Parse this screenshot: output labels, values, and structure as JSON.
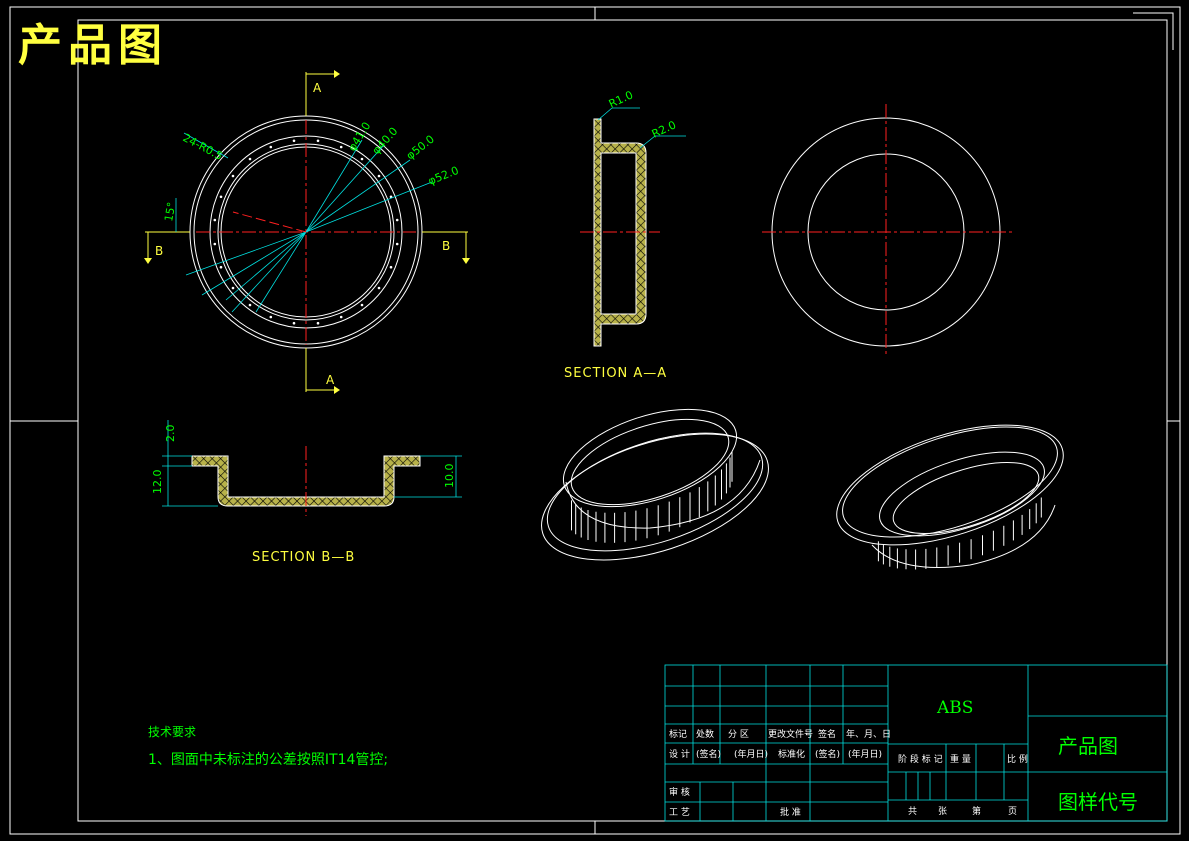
{
  "title": "产品图",
  "views": {
    "section_aa_label": "SECTION A—A",
    "section_bb_label": "SECTION B—B",
    "cut_a": "A",
    "cut_b": "B"
  },
  "dimensions": {
    "holes": "24-R0.5",
    "angle": "15°",
    "d1": "φ41.0",
    "d2": "φ40.0",
    "d3": "φ50.0",
    "d4": "φ52.0",
    "r1": "R1.0",
    "r2": "R2.0",
    "h_flange": "2.0",
    "h_total": "12.0",
    "h_inner": "10.0"
  },
  "tech_notes": {
    "heading": "技术要求",
    "line1": "1、图面中未标注的公差按照IT14管控;"
  },
  "title_block": {
    "material": "ABS",
    "drawing_name": "产品图",
    "drawing_code": "图样代号",
    "row_labels": [
      "标记",
      "处数",
      "分 区",
      "更改文件号",
      "签名",
      "年、月、日"
    ],
    "design_row": [
      "设 计",
      "(签名)",
      "(年月日)",
      "标准化",
      "(签名)",
      "(年月日)"
    ],
    "stage_labels": [
      "阶 段 标 记",
      "重 量",
      "比 例"
    ],
    "review": "审 核",
    "process": "工 艺",
    "approve": "批 准",
    "sheets": [
      "共",
      "张",
      "第",
      "页"
    ]
  }
}
